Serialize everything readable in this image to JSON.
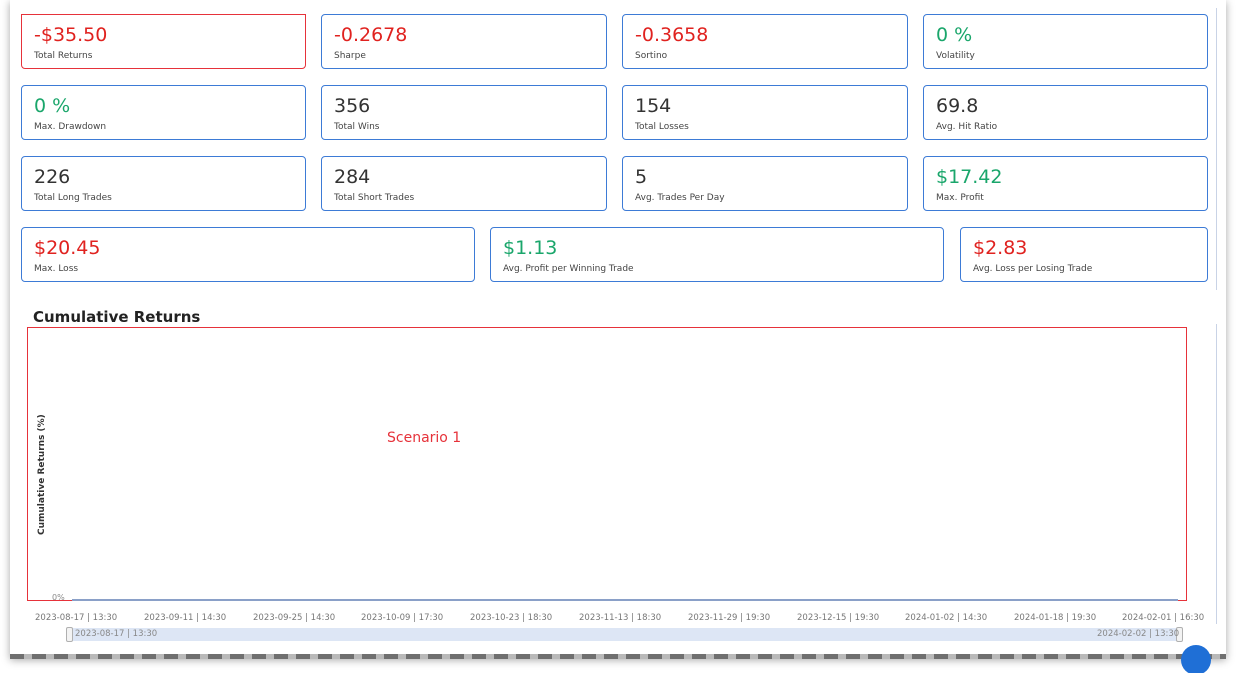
{
  "metrics": [
    {
      "value": "-$35.50",
      "label": "Total Returns",
      "tone": "neg"
    },
    {
      "value": "-0.2678",
      "label": "Sharpe",
      "tone": "neg"
    },
    {
      "value": "-0.3658",
      "label": "Sortino",
      "tone": "neg"
    },
    {
      "value": "0 %",
      "label": "Volatility",
      "tone": "pos"
    },
    {
      "value": "0 %",
      "label": "Max. Drawdown",
      "tone": "pos"
    },
    {
      "value": "356",
      "label": "Total Wins",
      "tone": "neu"
    },
    {
      "value": "154",
      "label": "Total Losses",
      "tone": "neu"
    },
    {
      "value": "69.8",
      "label": "Avg. Hit Ratio",
      "tone": "neu"
    },
    {
      "value": "226",
      "label": "Total Long Trades",
      "tone": "neu"
    },
    {
      "value": "284",
      "label": "Total Short Trades",
      "tone": "neu"
    },
    {
      "value": "5",
      "label": "Avg. Trades Per Day",
      "tone": "neu"
    },
    {
      "value": "$17.42",
      "label": "Max. Profit",
      "tone": "pos"
    },
    {
      "value": "$20.45",
      "label": "Max. Loss",
      "tone": "neg"
    },
    {
      "value": "$1.13",
      "label": "Avg. Profit per Winning Trade",
      "tone": "pos"
    },
    {
      "value": "$2.83",
      "label": "Avg. Loss per Losing Trade",
      "tone": "neg"
    }
  ],
  "chart": {
    "title": "Cumulative Returns",
    "ylabel": "Cumulative Returns (%)",
    "annotation": "Scenario 1",
    "ytick": "0%",
    "xticks": [
      "2023-08-17 | 13:30",
      "2023-09-11 | 14:30",
      "2023-09-25 | 14:30",
      "2023-10-09 | 17:30",
      "2023-10-23 | 18:30",
      "2023-11-13 | 18:30",
      "2023-11-29 | 19:30",
      "2023-12-15 | 19:30",
      "2024-01-02 | 14:30",
      "2024-01-18 | 19:30",
      "2024-02-01 | 16:30"
    ],
    "range_start": "2023-08-17 | 13:30",
    "range_end": "2024-02-02 | 13:30"
  },
  "chart_data": {
    "type": "line",
    "title": "Cumulative Returns",
    "xlabel": "",
    "ylabel": "Cumulative Returns (%)",
    "x": [
      "2023-08-17 | 13:30",
      "2023-09-11 | 14:30",
      "2023-09-25 | 14:30",
      "2023-10-09 | 17:30",
      "2023-10-23 | 18:30",
      "2023-11-13 | 18:30",
      "2023-11-29 | 19:30",
      "2023-12-15 | 19:30",
      "2024-01-02 | 14:30",
      "2024-01-18 | 19:30",
      "2024-02-01 | 16:30"
    ],
    "series": [
      {
        "values": [
          0,
          0,
          0,
          0,
          0,
          0,
          0,
          0,
          0,
          0,
          0
        ]
      }
    ],
    "annotations": [
      "Scenario 1"
    ],
    "grid": false
  },
  "colors": {
    "accent": "#3d7bd6",
    "negative": "#e0221f",
    "positive": "#1aa66b",
    "highlight": "#e6323a"
  }
}
